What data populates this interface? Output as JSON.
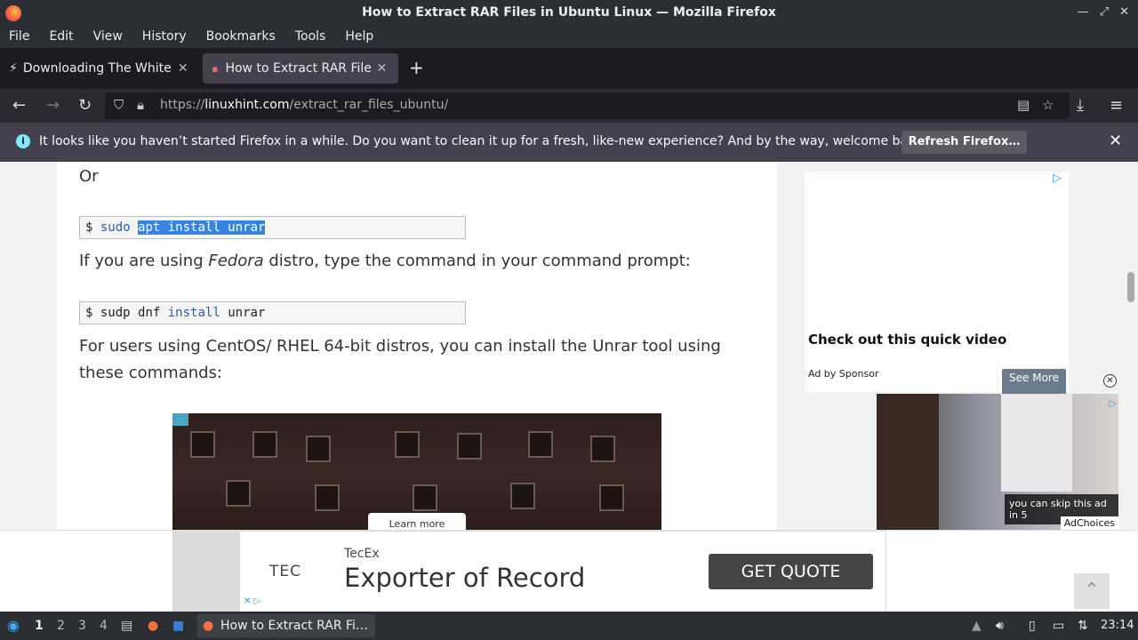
{
  "window": {
    "title": "How to Extract RAR Files in Ubuntu Linux — Mozilla Firefox"
  },
  "menu": [
    "File",
    "Edit",
    "View",
    "History",
    "Bookmarks",
    "Tools",
    "Help"
  ],
  "tabs": [
    {
      "label": "Downloading The White House"
    },
    {
      "label": "How to Extract RAR Files"
    }
  ],
  "address": {
    "prefix": "https://",
    "domain": "linuxhint.com",
    "path": "/extract_rar_files_ubuntu/"
  },
  "notification": {
    "message": "It looks like you haven’t started Firefox in a while. Do you want to clean it up for a fresh, like-new experience? And by the way, welcome back!",
    "button": "Refresh Firefox…"
  },
  "article": {
    "or": "Or",
    "cmd1": {
      "prompt": "$",
      "a": "sudo",
      "b": "apt install unrar"
    },
    "fedora_pre": "If you are using ",
    "fedora_em": "Fedora",
    "fedora_post": " distro, type the command in your command prompt:",
    "cmd2": {
      "prompt": "$",
      "a": "sudp dnf",
      "b": "install",
      "c": "unrar"
    },
    "centos_1": "For users using CentOS/ RHEL 64-bit distros, you can install the Unrar tool using",
    "centos_2": "these commands:",
    "video_learn": "Learn more"
  },
  "sidebar_ad": {
    "headline": "Check out this quick video",
    "sponsor": "Ad by Sponsor",
    "see_more": "See More"
  },
  "video_ad": {
    "skip": "you can skip this ad in 5",
    "choices": "AdChoices"
  },
  "bottom_ad": {
    "logo": "TEC",
    "brand": "TecEx",
    "headline": "Exporter of Record",
    "cta": "GET QUOTE"
  },
  "taskbar": {
    "workspaces": [
      "1",
      "2",
      "3",
      "4"
    ],
    "task": "How to Extract RAR Fi…",
    "clock": "23:14"
  }
}
